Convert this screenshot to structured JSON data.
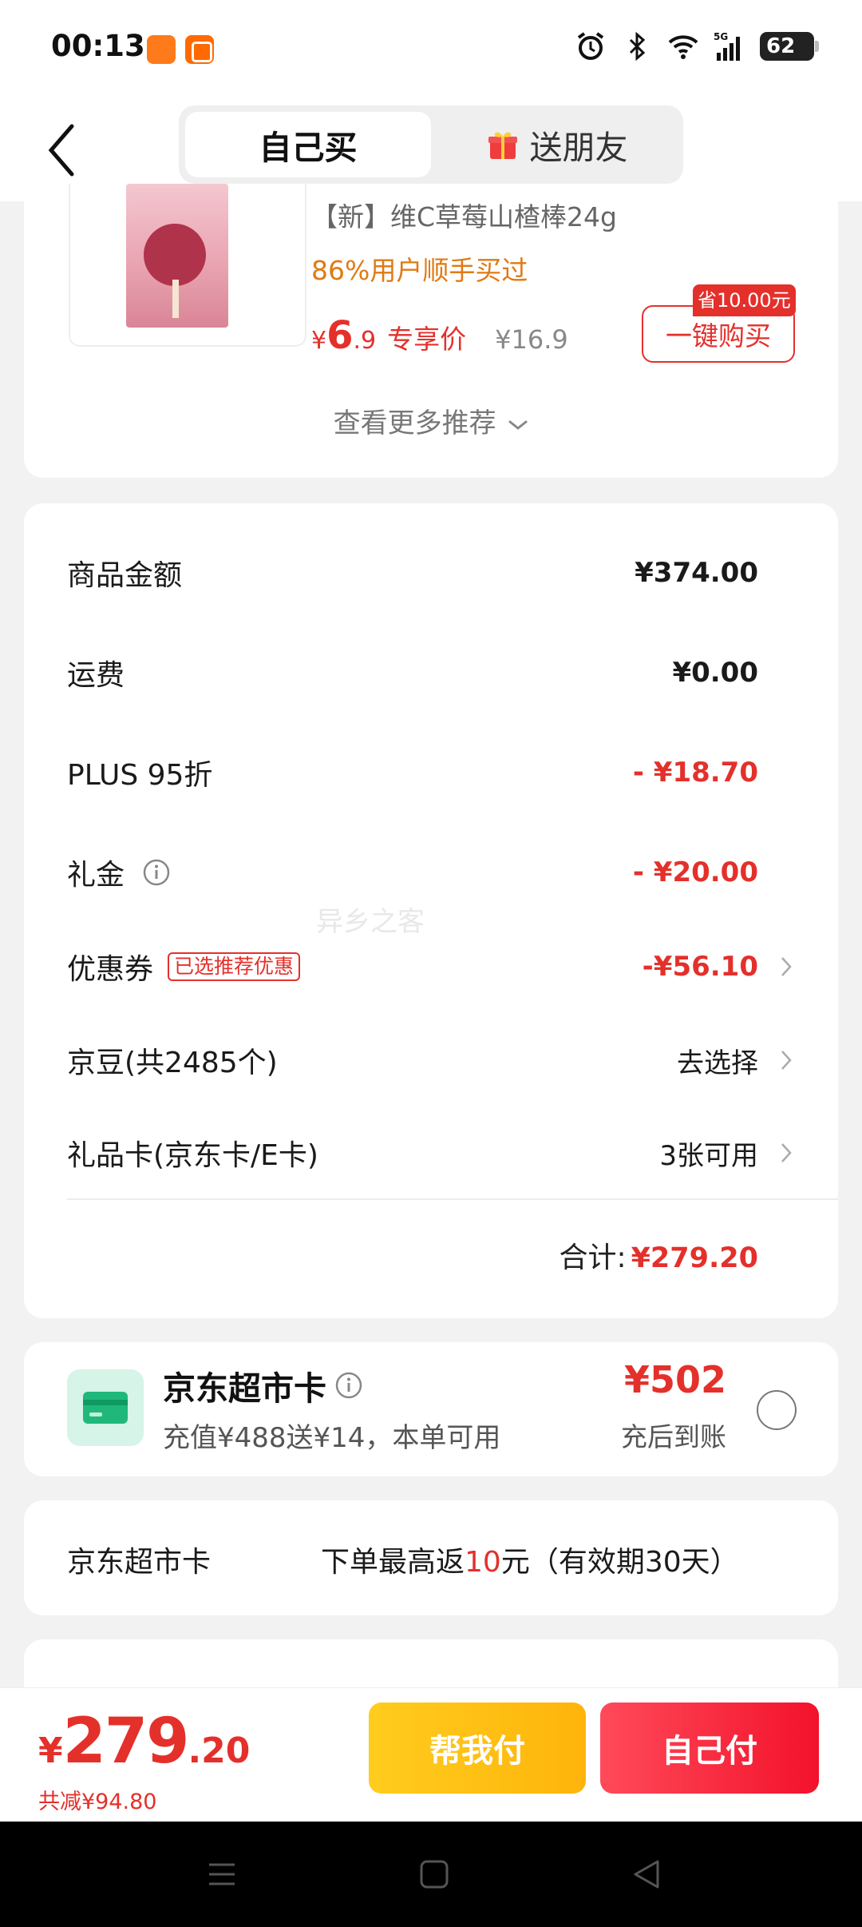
{
  "status_bar": {
    "time": "00:13",
    "battery": "62",
    "icons": [
      "alarm-icon",
      "bluetooth-icon",
      "wifi-icon",
      "5g-signal-icon",
      "battery-icon"
    ]
  },
  "header": {
    "tabs": [
      {
        "label": "自己买",
        "active": true
      },
      {
        "label": "送朋友",
        "active": false,
        "icon": "gift-icon"
      }
    ]
  },
  "recommend": {
    "product_title": "【新】维C草莓山楂棒24g",
    "bought_text": "86%用户顺手买过",
    "price_symbol": "¥",
    "price_int": "6",
    "price_dec": ".9",
    "price_tag": "专享价",
    "original_price": "¥16.9",
    "save_badge": "省10.00元",
    "buy_button": "一键购买",
    "more_label": "查看更多推荐"
  },
  "summary": {
    "goods_amount": {
      "label": "商品金额",
      "value": "¥374.00"
    },
    "shipping": {
      "label": "运费",
      "value": "¥0.00"
    },
    "plus_discount": {
      "label": "PLUS 95折",
      "value": "- ¥18.70"
    },
    "gift_money": {
      "label": "礼金",
      "value": "- ¥20.00"
    },
    "coupon": {
      "label": "优惠券",
      "tag": "已选推荐优惠",
      "value": "-¥56.10"
    },
    "jd_beans": {
      "label": "京豆(共2485个)",
      "value": "去选择"
    },
    "gift_card": {
      "label": "礼品卡(京东卡/E卡)",
      "value": "3张可用"
    },
    "total_label": "合计:",
    "total_value": "¥279.20"
  },
  "watermark": "异乡之客",
  "market_card": {
    "title": "京东超市卡",
    "subtitle": "充值¥488送¥14，本单可用",
    "amount": "¥502",
    "note": "充后到账"
  },
  "rebate": {
    "label": "京东超市卡",
    "text_pre": "下单最高返",
    "text_hl": "10",
    "text_post": "元（有效期30天）"
  },
  "bottom_bar": {
    "price_symbol": "¥",
    "price_int": "279",
    "price_dec": ".20",
    "saved": "共减¥94.80",
    "help_pay": "帮我付",
    "self_pay": "自己付"
  },
  "colors": {
    "accent_red": "#e4302b",
    "orange": "#e07a13",
    "help_yellow": "#ffb40a",
    "page_bg": "#f2f2f2"
  }
}
